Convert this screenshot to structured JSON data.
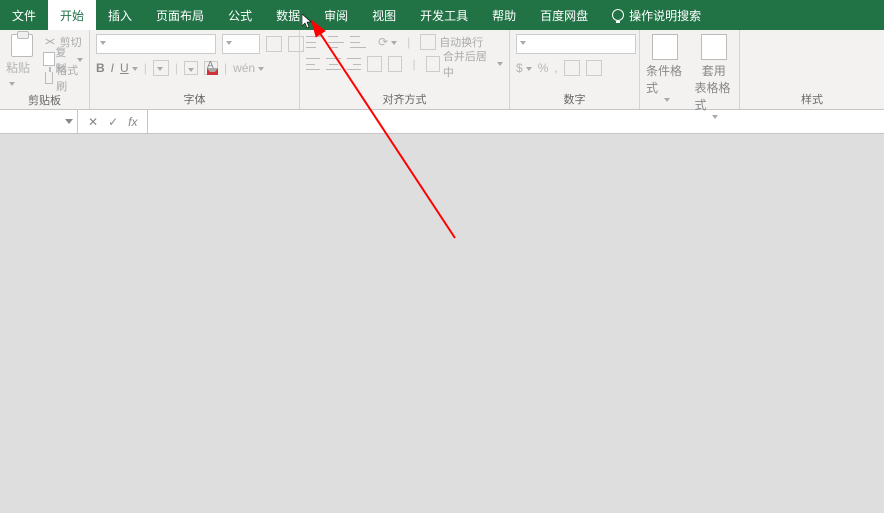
{
  "tabs": {
    "file": "文件",
    "home": "开始",
    "insert": "插入",
    "layout": "页面布局",
    "formulas": "公式",
    "data": "数据",
    "review": "审阅",
    "view": "视图",
    "dev": "开发工具",
    "help": "帮助",
    "baidu": "百度网盘",
    "tell_me": "操作说明搜索"
  },
  "groups": {
    "clipboard": "剪贴板",
    "font": "字体",
    "alignment": "对齐方式",
    "number": "数字",
    "styles": "样式"
  },
  "clipboard": {
    "paste": "粘贴",
    "cut": "剪切",
    "copy": "复制",
    "painter": "格式刷"
  },
  "font": {
    "bold": "B",
    "italic": "I",
    "underline": "U",
    "font_letter": "A"
  },
  "alignment": {
    "wrap": "自动换行",
    "merge": "合并后居中"
  },
  "styles": {
    "cond": "条件格式",
    "table": "套用",
    "table2": "表格格式"
  },
  "fx": {
    "cancel": "✕",
    "enter": "✓",
    "fx": "fx"
  }
}
